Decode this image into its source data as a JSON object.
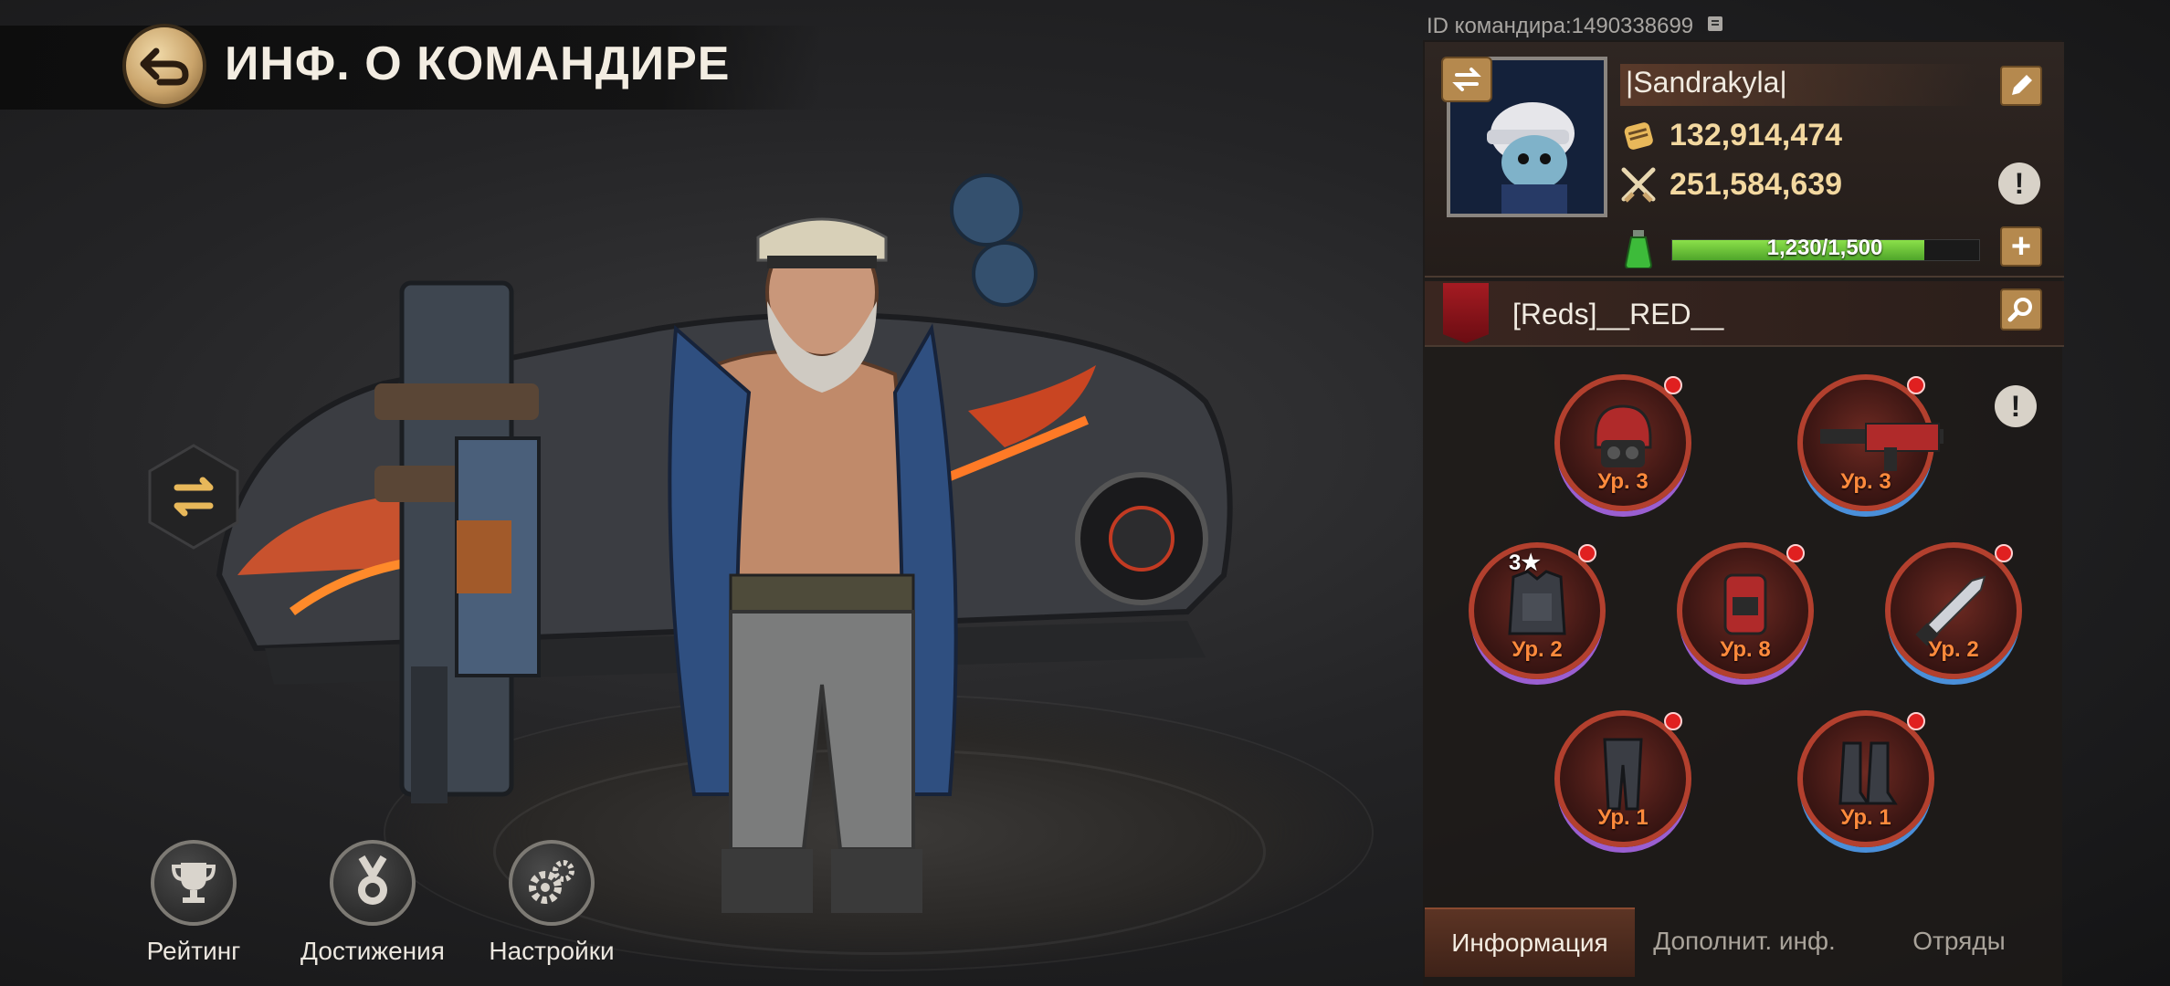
{
  "header": {
    "title": "ИНФ. О КОМАНДИРЕ",
    "commander_id": "ID командира:1490338699"
  },
  "profile": {
    "name": "|Sandrakyla|",
    "power": "132,914,474",
    "kills": "251,584,639",
    "stamina_text": "1,230/1,500",
    "stamina_fraction": 0.82
  },
  "alliance": {
    "name": "[Reds]__RED__"
  },
  "equipment": [
    {
      "label": "Ур. 3",
      "slot": "helmet"
    },
    {
      "label": "Ур. 3",
      "slot": "rifle"
    },
    {
      "label": "Ур. 2",
      "slot": "armor",
      "stars": "3★"
    },
    {
      "label": "Ур. 8",
      "slot": "backpack"
    },
    {
      "label": "Ур. 2",
      "slot": "knife"
    },
    {
      "label": "Ур. 1",
      "slot": "pants"
    },
    {
      "label": "Ур. 1",
      "slot": "boots"
    }
  ],
  "bottom_buttons": [
    {
      "label": "Рейтинг",
      "icon": "trophy-icon"
    },
    {
      "label": "Достижения",
      "icon": "medal-icon"
    },
    {
      "label": "Настройки",
      "icon": "gear-icon"
    }
  ],
  "tabs": [
    {
      "label": "Информация",
      "active": true
    },
    {
      "label": "Дополнит. инф.",
      "active": false
    },
    {
      "label": "Отряды",
      "active": false
    }
  ],
  "colors": {
    "accent": "#b5894e",
    "power_text": "#f3d8a0",
    "stamina": "#6cc23a",
    "alert_dot": "#e02020"
  }
}
